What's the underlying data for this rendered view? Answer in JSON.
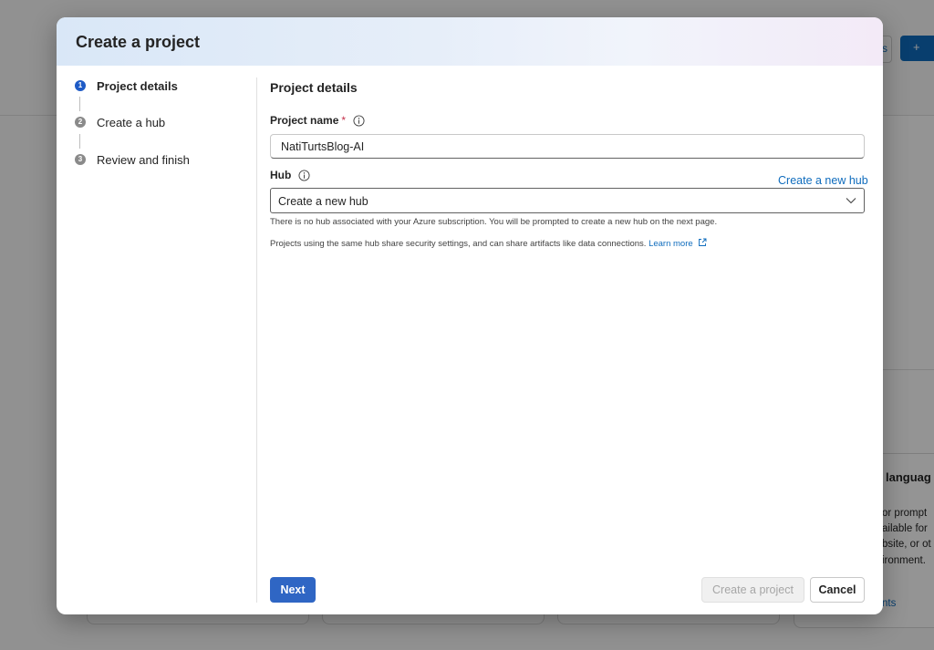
{
  "background": {
    "top_button_text": "s",
    "primary_button_text": "+",
    "card_title": "languag",
    "card_lines": [
      "or prompt",
      "ailable for",
      "bsite, or ot",
      "ironment."
    ],
    "card_link": "nts"
  },
  "dialog": {
    "title": "Create a project",
    "steps": [
      {
        "number": "1",
        "label": "Project details",
        "active": true
      },
      {
        "number": "2",
        "label": "Create a hub",
        "active": false
      },
      {
        "number": "3",
        "label": "Review and finish",
        "active": false
      }
    ],
    "section_title": "Project details",
    "project_name": {
      "label": "Project name",
      "required_marker": "*",
      "value": "NatiTurtsBlog-AI"
    },
    "hub": {
      "label": "Hub",
      "create_link": "Create a new hub",
      "selected": "Create a new hub",
      "help_text_1": "There is no hub associated with your Azure subscription. You will be prompted to create a new hub on the next page.",
      "help_text_2": "Projects using the same hub share security settings, and can share artifacts like data connections.",
      "learn_more": "Learn more"
    },
    "footer": {
      "next": "Next",
      "create": "Create a project",
      "cancel": "Cancel"
    }
  },
  "colors": {
    "accent": "#1e5bc6",
    "link": "#0f6cbd",
    "required": "#c4314b"
  }
}
